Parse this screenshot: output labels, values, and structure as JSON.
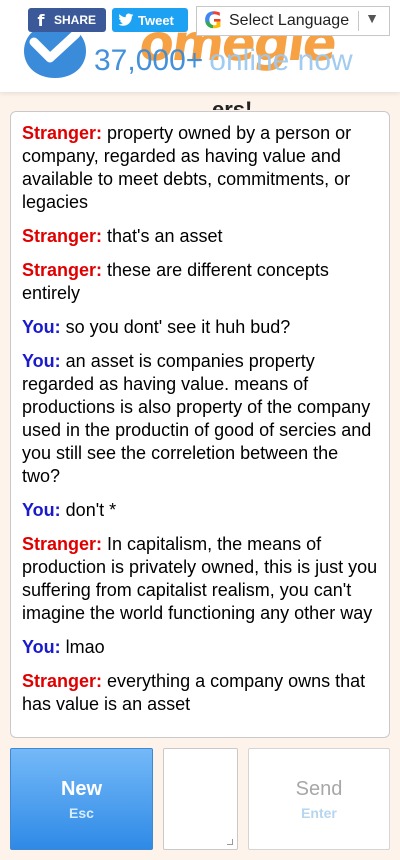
{
  "header": {
    "logo_word": "omegle",
    "online_number": "37,000+",
    "online_text": "online now",
    "share_label": "SHARE",
    "facebook_glyph": "f",
    "tweet_label": "Tweet",
    "language_select": "Select Language",
    "google_glyph": "G",
    "title_peek": "ers!"
  },
  "chat": {
    "messages": [
      {
        "who": "Stranger:",
        "text": "property owned by a person or company, regarded as having value and available to meet debts, commitments, or legacies"
      },
      {
        "who": "Stranger:",
        "text": "that's an asset"
      },
      {
        "who": "Stranger:",
        "text": "these are different concepts entirely"
      },
      {
        "who": "You:",
        "text": "so you dont' see it huh bud?"
      },
      {
        "who": "You:",
        "text": "an asset is companies property regarded as having value. means of productions is also property of the company used in the productin of good of sercies and you still see the correletion between the two?"
      },
      {
        "who": "You:",
        "text": "don't *"
      },
      {
        "who": "Stranger:",
        "text": "In capitalism, the means of production is privately owned, this is just you suffering from capitalist realism, you can't imagine the world functioning any other way"
      },
      {
        "who": "You:",
        "text": "lmao"
      },
      {
        "who": "Stranger:",
        "text": "everything a company owns that has value is an asset"
      }
    ]
  },
  "controls": {
    "new_label": "New",
    "new_key": "Esc",
    "send_label": "Send",
    "send_key": "Enter",
    "message_value": ""
  },
  "colors": {
    "stranger": "#e00000",
    "you": "#1a1acc",
    "new_button": "#2f8ae6",
    "logo_orange": "#f7a145",
    "logo_blue": "#3a8bd9"
  }
}
